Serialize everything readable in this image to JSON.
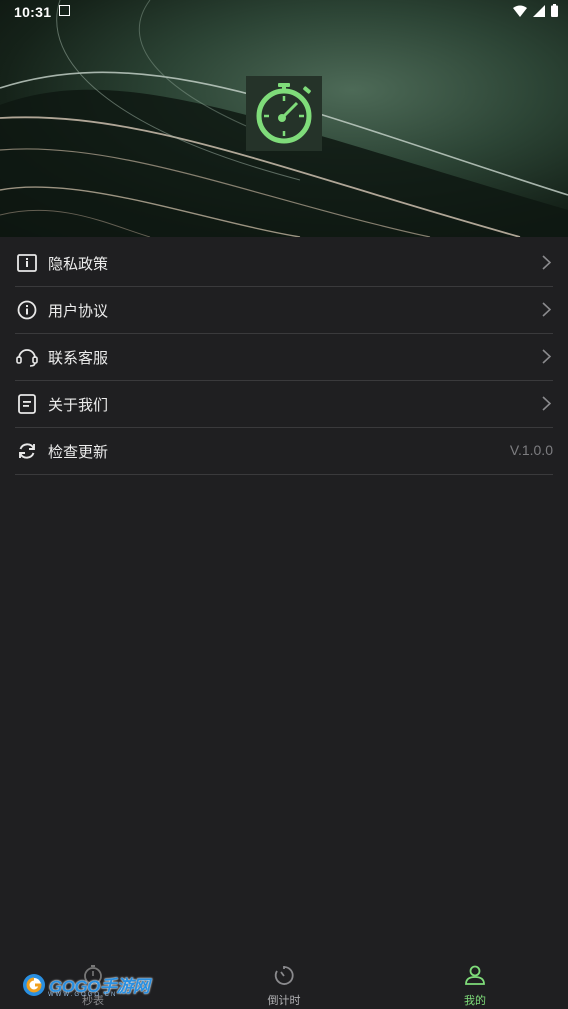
{
  "status_bar": {
    "time": "10:31"
  },
  "menu": {
    "items": [
      {
        "label": "隐私政策",
        "icon": "privacy-icon"
      },
      {
        "label": "用户协议",
        "icon": "info-icon"
      },
      {
        "label": "联系客服",
        "icon": "headset-icon"
      },
      {
        "label": "关于我们",
        "icon": "document-icon"
      },
      {
        "label": "检查更新",
        "icon": "refresh-icon"
      }
    ],
    "version": "V.1.0.0"
  },
  "tabbar": {
    "tabs": [
      {
        "label": "秒表",
        "active": false
      },
      {
        "label": "倒计时",
        "active": false
      },
      {
        "label": "我的",
        "active": true
      }
    ]
  },
  "watermark": {
    "text": "GOGO手游网",
    "sub": "WWW.GOGO.CN"
  },
  "colors": {
    "accent": "#7fdc7a",
    "background": "#1f1f21",
    "divider": "#3a3a3c"
  }
}
